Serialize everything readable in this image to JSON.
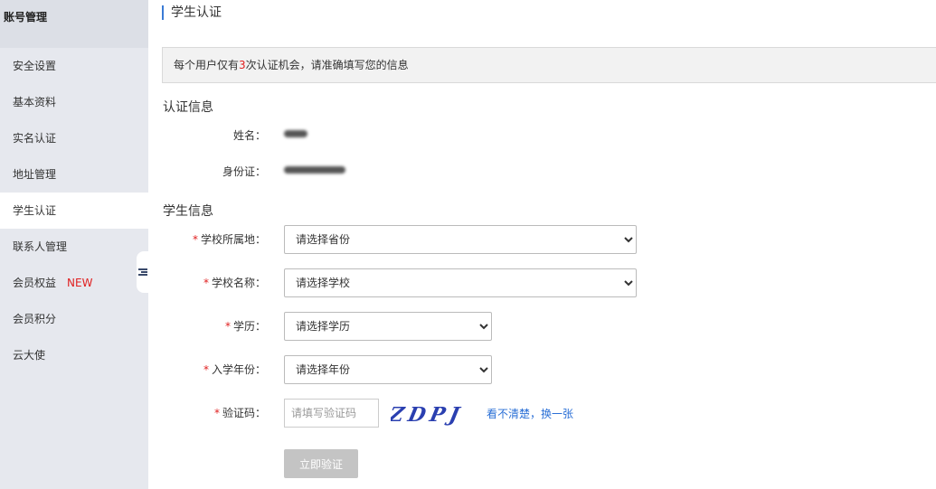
{
  "sidebar": {
    "header": "账号管理",
    "items": [
      {
        "label": "安全设置"
      },
      {
        "label": "基本资料"
      },
      {
        "label": "实名认证"
      },
      {
        "label": "地址管理"
      },
      {
        "label": "学生认证",
        "active": true
      },
      {
        "label": "联系人管理"
      },
      {
        "label": "会员权益",
        "badge": "NEW"
      },
      {
        "label": "会员积分"
      },
      {
        "label": "云大使"
      }
    ]
  },
  "page": {
    "title": "学生认证",
    "notice": {
      "prefix": "每个用户仅有",
      "count": "3",
      "suffix": "次认证机会，请准确填写您的信息"
    }
  },
  "auth_info": {
    "title": "认证信息",
    "name_label": "姓名：",
    "id_label": "身份证："
  },
  "student_info": {
    "title": "学生信息",
    "school_region": {
      "label": "学校所属地：",
      "selected": "请选择省份"
    },
    "school_name": {
      "label": "学校名称：",
      "selected": "请选择学校"
    },
    "education": {
      "label": "学历：",
      "selected": "请选择学历"
    },
    "enroll_year": {
      "label": "入学年份：",
      "selected": "请选择年份"
    },
    "captcha": {
      "label": "验证码：",
      "placeholder": "请填写验证码",
      "image_text": "ZDPJ",
      "refresh": "看不清楚，换一张"
    },
    "required_mark": "*",
    "submit": "立即验证"
  },
  "colors": {
    "accent": "#3a7bd5",
    "required": "#e02020",
    "link": "#2a6fd6",
    "disabled_button": "#c4c4c4"
  }
}
